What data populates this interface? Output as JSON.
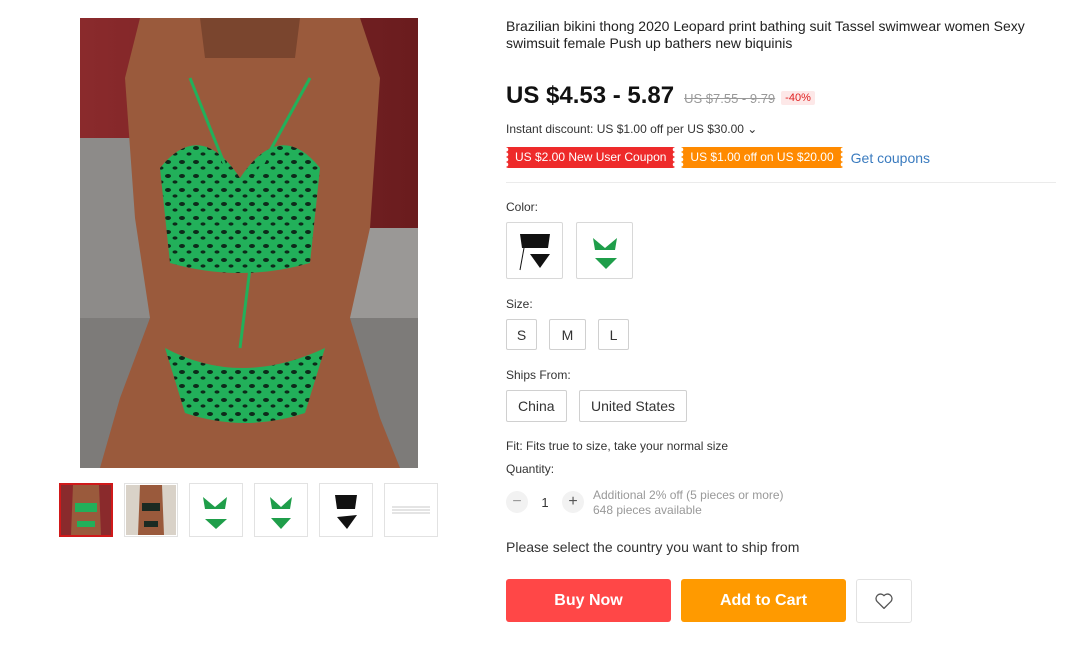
{
  "product": {
    "title": "Brazilian bikini thong 2020 Leopard print bathing suit Tassel swimwear women Sexy swimsuit female Push up bathers new biquinis",
    "price": "US $4.53 - 5.87",
    "original_price": "US $7.55 - 9.79",
    "discount_badge": "-40%",
    "instant_discount": "Instant discount: US $1.00 off per US $30.00 ⌄"
  },
  "coupons": {
    "new_user": "US $2.00 New User Coupon",
    "store": "US $1.00 off on US $20.00",
    "get_link": "Get coupons"
  },
  "options": {
    "color_label": "Color:",
    "size_label": "Size:",
    "sizes": [
      "S",
      "M",
      "L"
    ],
    "ships_from_label": "Ships From:",
    "ships_from": [
      "China",
      "United States"
    ],
    "fit_text": "Fit: Fits true to size, take your normal size"
  },
  "quantity": {
    "label": "Quantity:",
    "minus": "−",
    "plus": "+",
    "value": "1",
    "note_discount": "Additional 2% off (5 pieces or more)",
    "note_available": "648 pieces available"
  },
  "shipping": {
    "prompt": "Please select the country you want to ship from"
  },
  "actions": {
    "buy_now": "Buy Now",
    "add_to_cart": "Add to Cart"
  },
  "colors": {
    "accent_red": "#ff4747",
    "accent_orange": "#ff9a00",
    "link_blue": "#3a7bbf",
    "print_green": "#1f9e4a"
  },
  "icons": {
    "wishlist": "heart-outline-icon"
  }
}
